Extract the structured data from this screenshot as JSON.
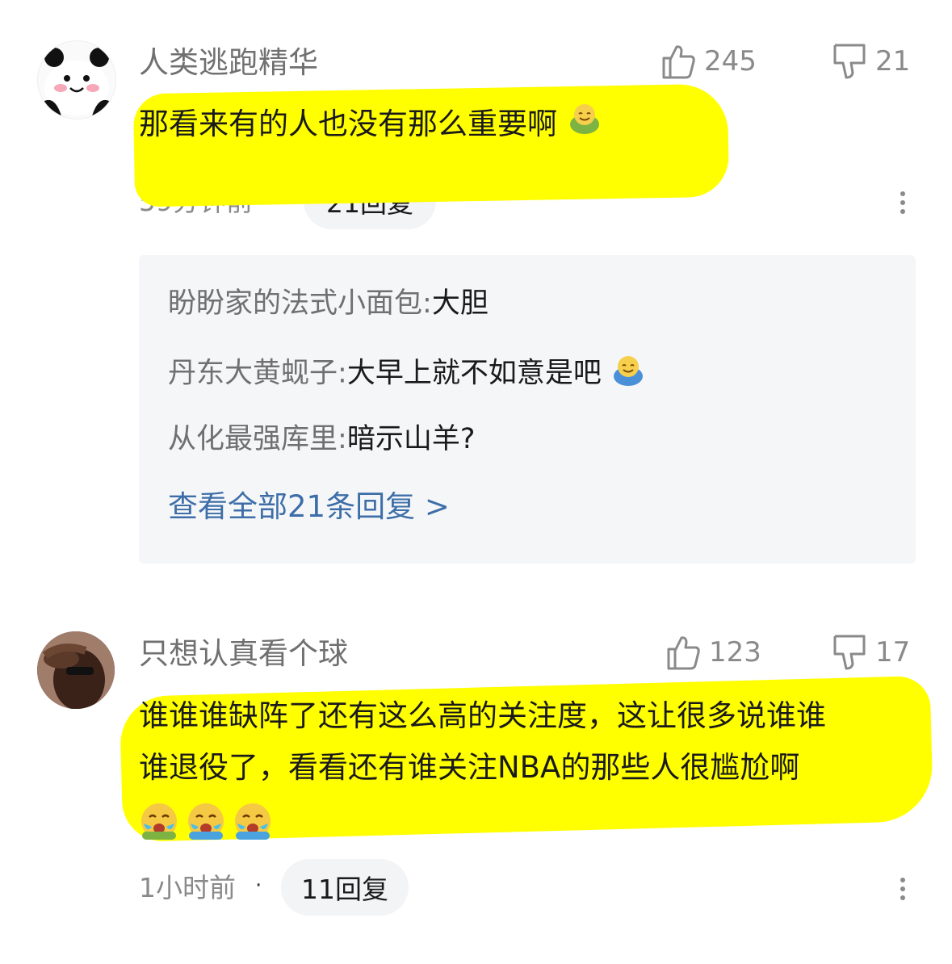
{
  "comments": [
    {
      "username": "人类逃跑精华",
      "text": "那看来有的人也没有那么重要啊",
      "like_count": "245",
      "dislike_count": "21",
      "time": "59分钟前",
      "reply_count": "21回复",
      "replies": [
        {
          "name": "盼盼家的法式小面包",
          "text": "大胆"
        },
        {
          "name": "丹东大黄蚬子",
          "text": "大早上就不如意是吧"
        },
        {
          "name": "从化最强库里",
          "text": "暗示山羊?"
        }
      ],
      "view_all": "查看全部21条回复 >"
    },
    {
      "username": "只想认真看个球",
      "text_line1": "谁谁谁缺阵了还有这么高的关注度，这让很多说谁谁",
      "text_line2": "谁退役了，看看还有谁关注NBA的那些人很尴尬啊",
      "like_count": "123",
      "dislike_count": "17",
      "time": "1小时前",
      "reply_count": "11回复"
    }
  ],
  "separator": ":",
  "dot": "·",
  "colors": {
    "highlight": "#ffff00",
    "link": "#3d6ea8",
    "muted": "#8a8a8a"
  },
  "icons": [
    "thumbs-up-icon",
    "thumbs-down-icon",
    "more-vertical-icon",
    "smile-emoji-icon",
    "crying-emoji-icon"
  ]
}
